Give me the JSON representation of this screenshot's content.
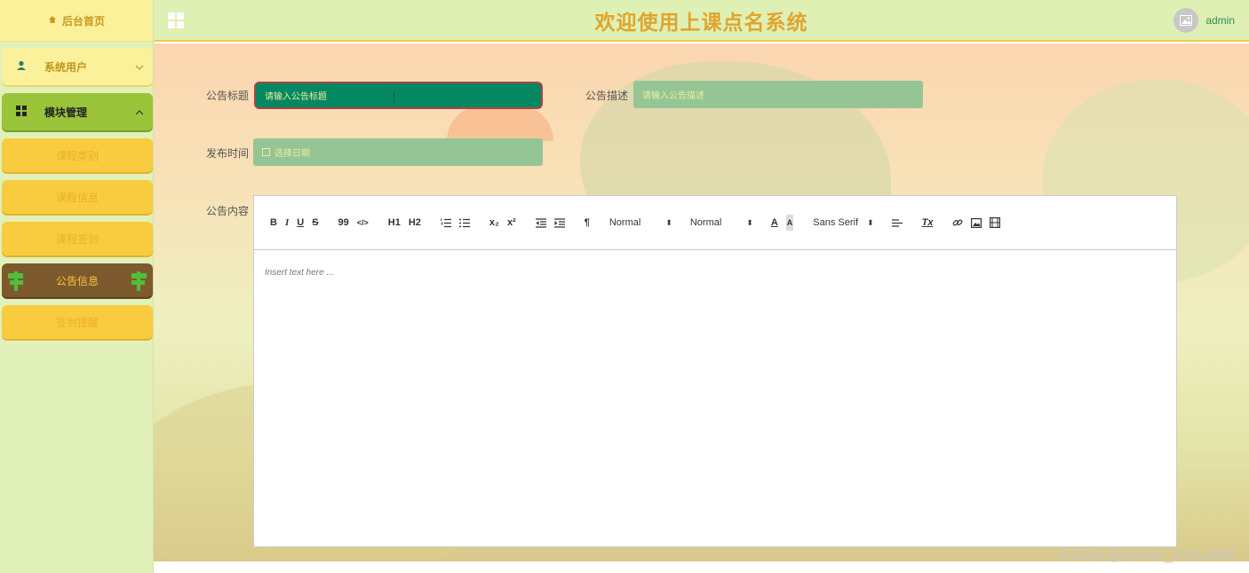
{
  "sidebar": {
    "home_label": "后台首页",
    "menus": [
      {
        "label": "系统用户"
      },
      {
        "label": "模块管理"
      }
    ],
    "sub_items": [
      {
        "label": "课程类别"
      },
      {
        "label": "课程信息"
      },
      {
        "label": "课程签到"
      },
      {
        "label": "公告信息"
      },
      {
        "label": "签到提醒"
      }
    ]
  },
  "header": {
    "title": "欢迎使用上课点名系统",
    "username": "admin"
  },
  "form": {
    "title_label": "公告标题",
    "title_placeholder": "请输入公告标题",
    "desc_label": "公告描述",
    "desc_placeholder": "请输入公告描述",
    "date_label": "发布时间",
    "date_placeholder": "选择日期",
    "content_label": "公告内容"
  },
  "editor": {
    "toolbar": {
      "bold": "B",
      "italic": "I",
      "underline": "U",
      "strike": "S",
      "quote": "99",
      "code": "</>",
      "h1": "H1",
      "h2": "H2",
      "subscript": "x₂",
      "superscript": "x²",
      "direction": "¶",
      "size_select": "Normal",
      "header_select": "Normal",
      "color": "A",
      "background": "A",
      "font_select": "Sans Serif",
      "clean": "Tx"
    },
    "placeholder": "Insert text here ..."
  },
  "watermark": "CSDN @weixin_ZYKJ985",
  "colors": {
    "sidebar_bg": "#e2f0b9",
    "title_color": "#e0a42d",
    "active_item_bg": "#7d5a2d",
    "submenu_bg": "#f9cc3f",
    "focused_input_bg": "#048862"
  }
}
